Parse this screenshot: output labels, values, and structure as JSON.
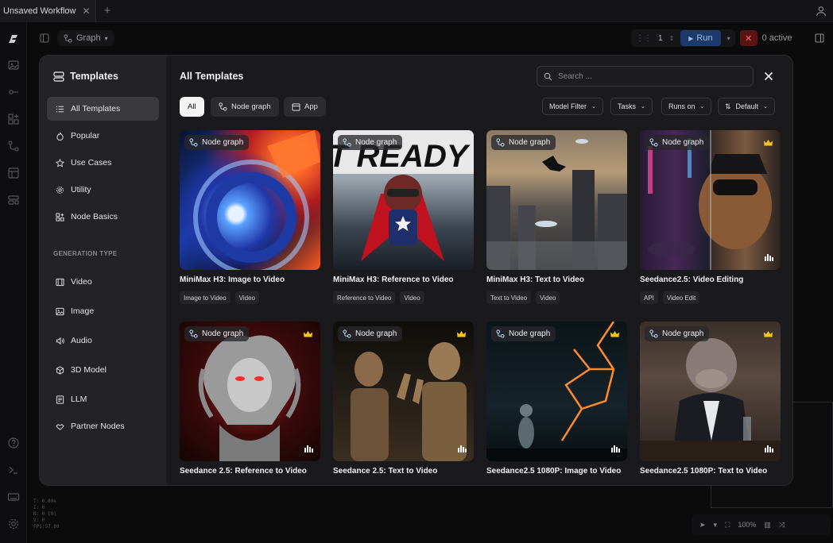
{
  "tab": {
    "title": "Unsaved Workflow",
    "close": "✕",
    "add": "+"
  },
  "toolbar": {
    "graph_label": "Graph",
    "queue_count": "1",
    "run_label": "Run",
    "stop": "✕",
    "active_label": "0 active"
  },
  "stats": [
    "T: 0.00s",
    "I: 0",
    "N: 0 [0]",
    "V: 0",
    "FPS:57.80"
  ],
  "zoom": "100%",
  "modal": {
    "sidebar_title": "Templates",
    "nav": [
      {
        "label": "All Templates",
        "icon": "list-icon",
        "active": true
      },
      {
        "label": "Popular",
        "icon": "flame-icon"
      },
      {
        "label": "Use Cases",
        "icon": "star-icon"
      },
      {
        "label": "Utility",
        "icon": "gear-icon"
      },
      {
        "label": "Node Basics",
        "icon": "blocks-icon"
      }
    ],
    "section_label": "GENERATION TYPE",
    "gen_types": [
      {
        "label": "Video",
        "icon": "film-icon"
      },
      {
        "label": "Image",
        "icon": "image-icon"
      },
      {
        "label": "Audio",
        "icon": "speaker-icon"
      },
      {
        "label": "3D Model",
        "icon": "cube-icon"
      },
      {
        "label": "LLM",
        "icon": "document-icon"
      },
      {
        "label": "Partner Nodes",
        "icon": "handshake-icon"
      }
    ],
    "main_title": "All Templates",
    "search_placeholder": "Search ...",
    "chips": [
      "All",
      "Node graph",
      "App"
    ],
    "filters": [
      "Model Filter",
      "Tasks",
      "Runs on",
      "Default"
    ],
    "badge_label": "Node graph",
    "cards": [
      {
        "title": "MiniMax H3: Image to Video",
        "tags": [
          "Image to Video",
          "Video"
        ],
        "premium": false
      },
      {
        "title": "MiniMax H3: Reference to Video",
        "tags": [
          "Reference to Video",
          "Video"
        ],
        "premium": false
      },
      {
        "title": "MiniMax H3: Text to Video",
        "tags": [
          "Text to Video",
          "Video"
        ],
        "premium": false
      },
      {
        "title": "Seedance2.5: Video Editing",
        "tags": [
          "API",
          "Video Edit"
        ],
        "premium": true
      },
      {
        "title": "Seedance 2.5: Reference to Video",
        "tags": [],
        "premium": true
      },
      {
        "title": "Seedance 2.5: Text to Video",
        "tags": [],
        "premium": true
      },
      {
        "title": "Seedance2.5 1080P: Image to Video",
        "tags": [],
        "premium": true
      },
      {
        "title": "Seedance2.5 1080P: Text to Video",
        "tags": [],
        "premium": true
      }
    ],
    "thumb_text": "T READY"
  },
  "colors": {
    "accent": "#1e3a6b",
    "crown": "#f5c518",
    "danger": "#5b1414"
  }
}
